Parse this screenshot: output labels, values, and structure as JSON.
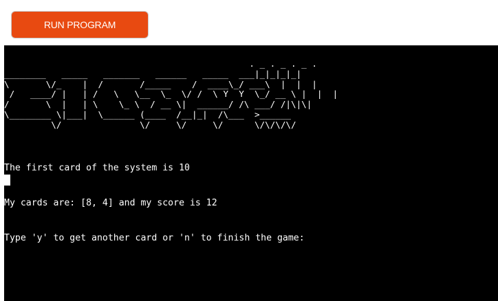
{
  "toolbar": {
    "run_button_label": "RUN PROGRAM",
    "run_button_color": "#e84a11"
  },
  "terminal": {
    "background_color": "#000000",
    "text_color": "#ffffff",
    "banner_ascii": "                                               . _ . _ . _ .\n________   _____   _______   ______   _____  ___|_|_|_|_|\n\\       \\/_    |  /       /_____    /  ____\\_/ ___\\  |  |  |\n /   ____/ |   | /   \\   \\__  \\_  \\/ /  \\ Y  Y  \\_/ __ \\ |  |  |\n/       \\  |   | \\    \\_ \\  / __ \\|  ______/ /\\ ___/ /|\\|\\|\n\\________ \\|___|  \\______ (____  /__|_|  /\\___  >______\n         \\/               \\/     \\/     \\/      \\/\\/\\/\\/",
    "lines": [
      "The first card of the system is 10",
      "My cards are: [8, 4] and my score is 12",
      "Type 'y' to get another card or 'n' to finish the game:"
    ]
  }
}
